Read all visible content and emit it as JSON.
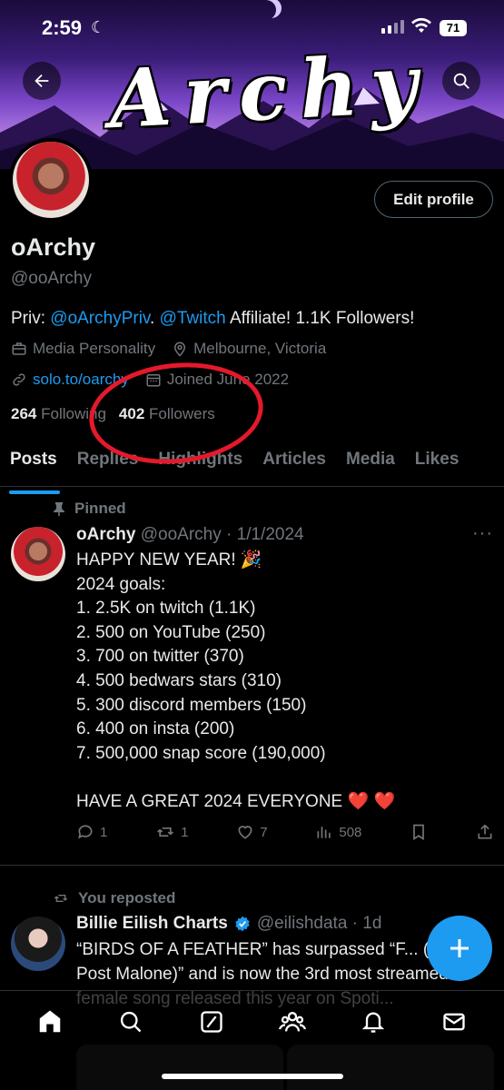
{
  "status_bar": {
    "time": "2:59",
    "battery": "71"
  },
  "banner": {
    "title": "Archy"
  },
  "profile": {
    "edit_label": "Edit profile",
    "name": "oArchy",
    "handle": "@ooArchy",
    "bio_prefix": "Priv: ",
    "bio_link1": "@oArchyPriv",
    "bio_mid": ". ",
    "bio_link2": "@Twitch",
    "bio_suffix": " Affiliate! 1.1K Followers!",
    "category": "Media Personality",
    "location": "Melbourne, Victoria",
    "website": "solo.to/oarchy",
    "joined": "Joined June 2022",
    "following_count": "264",
    "following_label": "Following",
    "followers_count": "402",
    "followers_label": "Followers"
  },
  "tabs": [
    {
      "label": "Posts"
    },
    {
      "label": "Replies"
    },
    {
      "label": "Highlights"
    },
    {
      "label": "Articles"
    },
    {
      "label": "Media"
    },
    {
      "label": "Likes"
    }
  ],
  "pinned_tweet": {
    "pinned_label": "Pinned",
    "display_name": "oArchy",
    "handle_date": "@ooArchy · 1/1/2024",
    "body": "HAPPY NEW YEAR! 🎉\n2024 goals:\n1. 2.5K on twitch (1.1K)\n2. 500 on YouTube (250)\n3. 700 on twitter (370)\n4. 500 bedwars stars (310)\n5. 300 discord members (150)\n6. 400 on insta (200)\n7. 500,000 snap score (190,000)\n\nHAVE A GREAT 2024 EVERYONE ❤️ ❤️",
    "replies": "1",
    "reposts": "1",
    "likes": "7",
    "views": "508"
  },
  "repost_tweet": {
    "repost_label": "You reposted",
    "display_name": "Billie Eilish Charts",
    "handle_date": "@eilishdata · 1d",
    "body": "“BIRDS OF A FEATHER” has surpassed “F... (feat. Post Malone)” and is now the 3rd most streamed female song released this year on Spoti..."
  },
  "colors": {
    "accent": "#1d9bf0",
    "annotation_circle": "#e4192c",
    "background": "#000000"
  }
}
